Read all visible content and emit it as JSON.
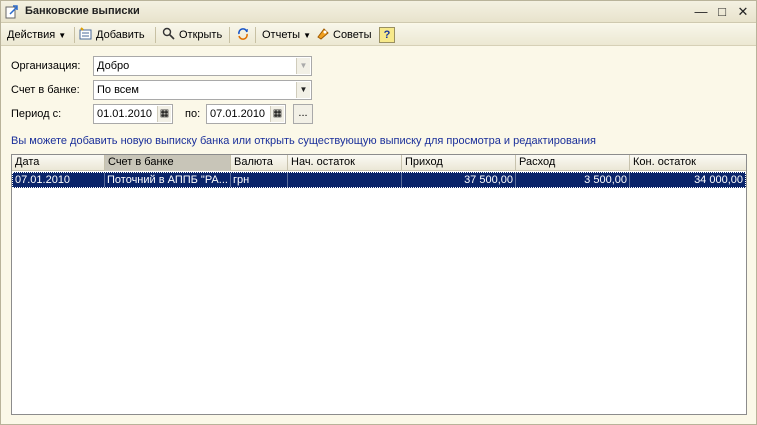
{
  "window": {
    "title": "Банковские выписки"
  },
  "toolbar": {
    "actions": "Действия",
    "add": "Добавить",
    "open": "Открыть",
    "reports": "Отчеты",
    "tips": "Советы"
  },
  "form": {
    "org_label": "Организация:",
    "org_value": "Добро",
    "account_label": "Счет в банке:",
    "account_value": "По всем",
    "period_label": "Период с:",
    "period_from": "01.01.2010",
    "period_to_label": "по:",
    "period_to": "07.01.2010",
    "period_button": "..."
  },
  "hint": "Вы можете добавить новую выписку банка или открыть существующую выписку для просмотра и редактирования",
  "table": {
    "columns": [
      "Дата",
      "Счет в банке",
      "Валюта",
      "Нач. остаток",
      "Приход",
      "Расход",
      "Кон. остаток"
    ],
    "rows": [
      {
        "date": "07.01.2010",
        "account": "Поточний в АППБ \"РА...",
        "currency": "грн",
        "opening": "",
        "income": "37 500,00",
        "expense": "3 500,00",
        "closing": "34 000,00"
      }
    ]
  }
}
